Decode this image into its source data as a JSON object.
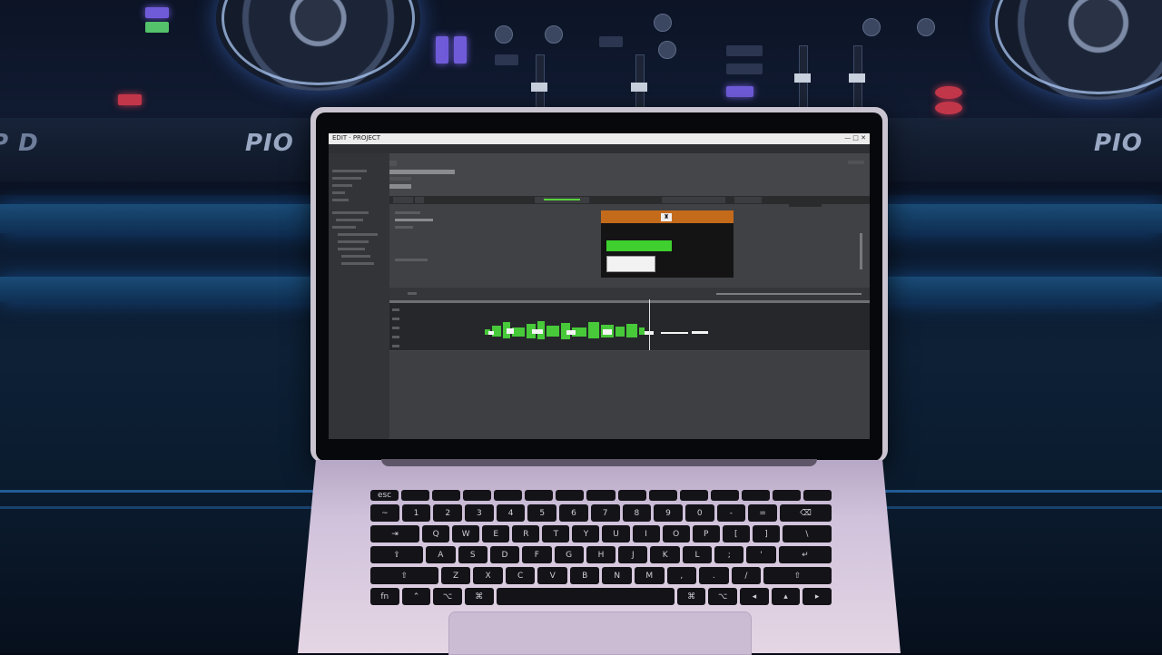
{
  "scene": {
    "brand_mark": "PIO",
    "brand_mark_far_left": "P D"
  },
  "app": {
    "window_title": "EDIT · PROJECT",
    "window_controls": "— □ ✕",
    "playback_icon": "trophy-icon"
  },
  "colors": {
    "accent_orange": "#c46a1b",
    "accent_green": "#3fd02f",
    "ambient_blue": "#3aa0ff"
  },
  "keyboard": {
    "rows": [
      [
        "esc",
        "",
        "",
        "",
        "",
        "",
        "",
        "",
        "",
        "",
        "",
        "",
        "",
        "",
        ""
      ],
      [
        "~",
        "1",
        "2",
        "3",
        "4",
        "5",
        "6",
        "7",
        "8",
        "9",
        "0",
        "-",
        "=",
        "⌫"
      ],
      [
        "⇥",
        "Q",
        "W",
        "E",
        "R",
        "T",
        "Y",
        "U",
        "I",
        "O",
        "P",
        "[",
        "]",
        "\\"
      ],
      [
        "⇪",
        "A",
        "S",
        "D",
        "F",
        "G",
        "H",
        "J",
        "K",
        "L",
        ";",
        "'",
        "↵"
      ],
      [
        "⇧",
        "Z",
        "X",
        "C",
        "V",
        "B",
        "N",
        "M",
        ",",
        ".",
        "/",
        "⇧"
      ],
      [
        "fn",
        "⌃",
        "⌥",
        "⌘",
        "",
        "⌘",
        "⌥",
        "◂",
        "▴",
        "▸"
      ]
    ]
  }
}
